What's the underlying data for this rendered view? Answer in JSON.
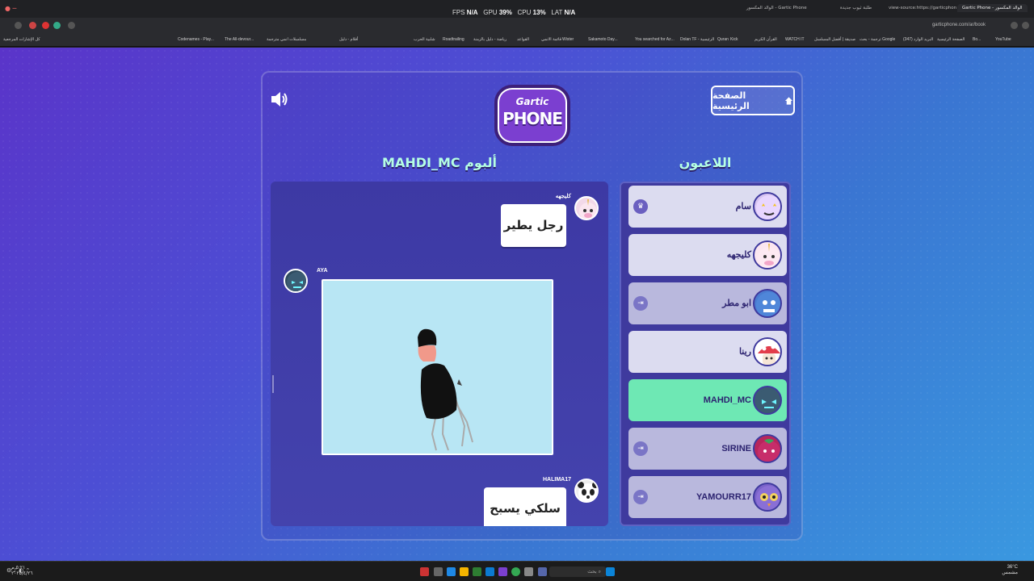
{
  "browser": {
    "perf": {
      "fps_label": "FPS",
      "fps": "N/A",
      "gpu_label": "GPU",
      "gpu": "39%",
      "cpu_label": "CPU",
      "cpu": "13%",
      "lat_label": "LAT",
      "lat": "N/A"
    },
    "tabs": [
      "الوالد المكسور - Gartic Phone",
      "طلبة ثيوب جديدة",
      "view-source:https://garticphon",
      "Gartic Phone - الوالد المكسور"
    ],
    "url": "garticphone.com/ar/book",
    "bookmarks": [
      "كل الإشارات المرجعية",
      "YouTube",
      "Bo...",
      "الصفحة الرئيسية",
      "(347) البريد الوارد",
      "ترجمة - بحث Google",
      "صديقة | أفضل المسلسل",
      "WATCH IT",
      "القرآن الكريم",
      "Kick",
      "Quran",
      "Dolan TF - الرئيسية",
      "You searched for Az...",
      "Sakamoto Day...",
      "Wister",
      "قائمة الانمي",
      "القواعد",
      "Roadtrailing",
      "شلبية الحرب",
      "رياضة - دليل بالزمنة",
      "أفلام - دليل",
      "مسلسلات انمي مترجمة",
      "The All-devour...",
      "Codenames - Play..."
    ]
  },
  "header": {
    "home_label": "الصفحة الرئيسية",
    "logo_top": "Gartic",
    "logo_bottom": "PHONE",
    "album_title": "ألبوم MAHDI_MC",
    "players_title": "اللاعبون"
  },
  "album": {
    "entries": [
      {
        "author": "كليجهه",
        "text": "رجل يطير"
      },
      {
        "author": "AYA",
        "text": ""
      },
      {
        "author": "HALIMA17",
        "text": "سلكي يسبح"
      }
    ]
  },
  "players": [
    {
      "name": "سام",
      "badge": "crown"
    },
    {
      "name": "كليجهه",
      "badge": ""
    },
    {
      "name": "ابو مطر",
      "badge": "exit"
    },
    {
      "name": "رينا",
      "badge": ""
    },
    {
      "name": "MAHDI_MC",
      "badge": ""
    },
    {
      "name": "SIRINE",
      "badge": "exit"
    },
    {
      "name": "YAMOURR17",
      "badge": "exit"
    }
  ],
  "taskbar": {
    "search": "بحث",
    "time": "٥:٢١ م",
    "date": "٢٠٢٥/٤/٢٦",
    "weather": "36°C",
    "weather_desc": "مشمس"
  }
}
